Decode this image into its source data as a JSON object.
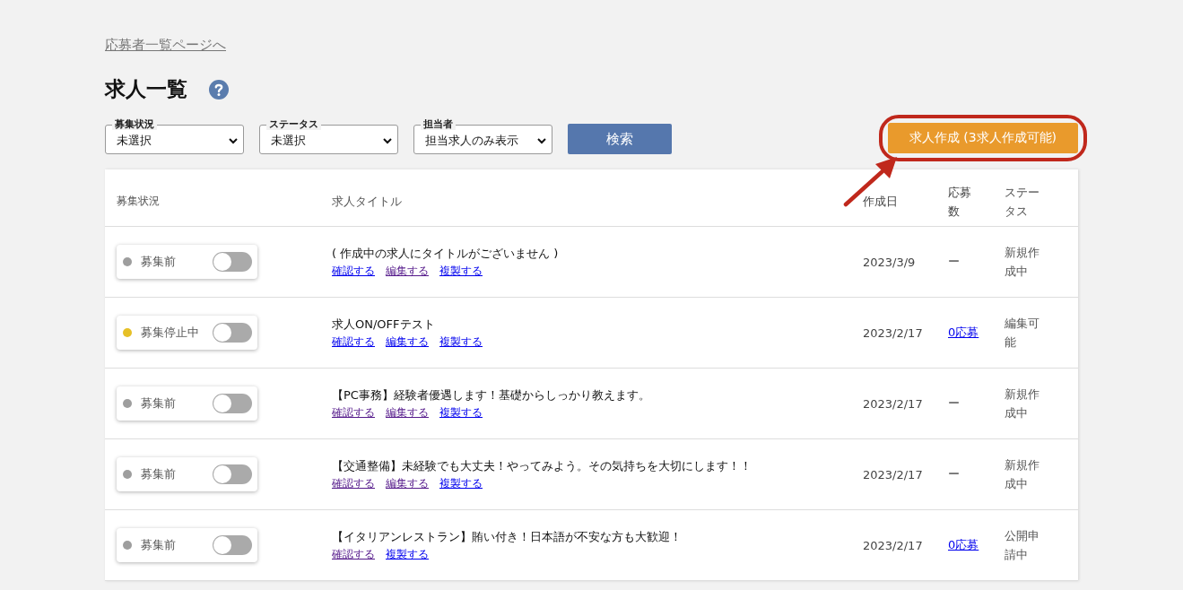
{
  "back_link": "応募者一覧ページへ",
  "page_title": "求人一覧",
  "filters": [
    {
      "label": "募集状況",
      "value": "未選択"
    },
    {
      "label": "ステータス",
      "value": "未選択"
    },
    {
      "label": "担当者",
      "value": "担当求人のみ表示"
    }
  ],
  "search_button": "検索",
  "create_button": "求人作成 (3求人作成可能)",
  "table": {
    "columns": [
      "募集状況",
      "求人タイトル",
      "作成日",
      "応募数",
      "ステータス"
    ],
    "rows": [
      {
        "recruit_state": "募集前",
        "color": "#9e9e9e",
        "on": false,
        "title": "( 作成中の求人にタイトルがございません )",
        "links": [
          {
            "label": "確認する",
            "visited": false
          },
          {
            "label": "編集する",
            "visited": true
          },
          {
            "label": "複製する",
            "visited": false
          }
        ],
        "created": "2023/3/9",
        "applications": {
          "kind": "text",
          "text": "ー"
        },
        "status": "新規作成中"
      },
      {
        "recruit_state": "募集停止中",
        "color": "#e6c027",
        "on": false,
        "title": "求人ON/OFFテスト",
        "links": [
          {
            "label": "確認する",
            "visited": false
          },
          {
            "label": "編集する",
            "visited": false
          },
          {
            "label": "複製する",
            "visited": false
          }
        ],
        "created": "2023/2/17",
        "applications": {
          "kind": "link",
          "text": "0応募"
        },
        "status": "編集可能"
      },
      {
        "recruit_state": "募集前",
        "color": "#9e9e9e",
        "on": false,
        "title": "【PC事務】経験者優遇します！基礎からしっかり教えます。",
        "links": [
          {
            "label": "確認する",
            "visited": true
          },
          {
            "label": "編集する",
            "visited": true
          },
          {
            "label": "複製する",
            "visited": false
          }
        ],
        "created": "2023/2/17",
        "applications": {
          "kind": "text",
          "text": "ー"
        },
        "status": "新規作成中"
      },
      {
        "recruit_state": "募集前",
        "color": "#9e9e9e",
        "on": false,
        "title": "【交通整備】未経験でも大丈夫！やってみよう。その気持ちを大切にします！！",
        "links": [
          {
            "label": "確認する",
            "visited": true
          },
          {
            "label": "編集する",
            "visited": true
          },
          {
            "label": "複製する",
            "visited": false
          }
        ],
        "created": "2023/2/17",
        "applications": {
          "kind": "text",
          "text": "ー"
        },
        "status": "新規作成中"
      },
      {
        "recruit_state": "募集前",
        "color": "#9e9e9e",
        "on": false,
        "title": "【イタリアンレストラン】賄い付き！日本語が不安な方も大歓迎！",
        "links": [
          {
            "label": "確認する",
            "visited": true
          },
          {
            "label": "複製する",
            "visited": false
          }
        ],
        "created": "2023/2/17",
        "applications": {
          "kind": "link",
          "text": "0応募"
        },
        "status": "公開申請中"
      }
    ]
  }
}
